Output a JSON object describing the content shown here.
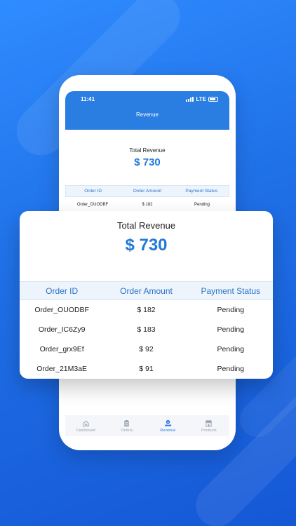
{
  "status_bar": {
    "time": "11:41",
    "network": "LTE"
  },
  "appbar": {
    "title": "Revenue"
  },
  "summary": {
    "label": "Total Revenue",
    "amount": "$ 730"
  },
  "table": {
    "headers": [
      "Order ID",
      "Order Amount",
      "Payment Status"
    ],
    "rows": [
      {
        "order_id": "Order_OUODBF",
        "amount": "$ 182",
        "status": "Pending"
      },
      {
        "order_id": "Order_IC6Zy9",
        "amount": "$ 183",
        "status": "Pending"
      },
      {
        "order_id": "Order_grx9Ef",
        "amount": "$ 92",
        "status": "Pending"
      },
      {
        "order_id": "Order_21M3aE",
        "amount": "$ 91",
        "status": "Pending"
      }
    ]
  },
  "tabs": [
    {
      "label": "Dashboard",
      "icon": "home-icon",
      "active": false
    },
    {
      "label": "Orders",
      "icon": "clipboard-icon",
      "active": false
    },
    {
      "label": "Revenue",
      "icon": "revenue-hand-icon",
      "active": true
    },
    {
      "label": "Products",
      "icon": "store-icon",
      "active": false
    }
  ],
  "colors": {
    "background": "#1f6fe6",
    "accent": "#2a7de1",
    "amount": "#2278d8",
    "table_header_bg": "#eef4fc"
  }
}
